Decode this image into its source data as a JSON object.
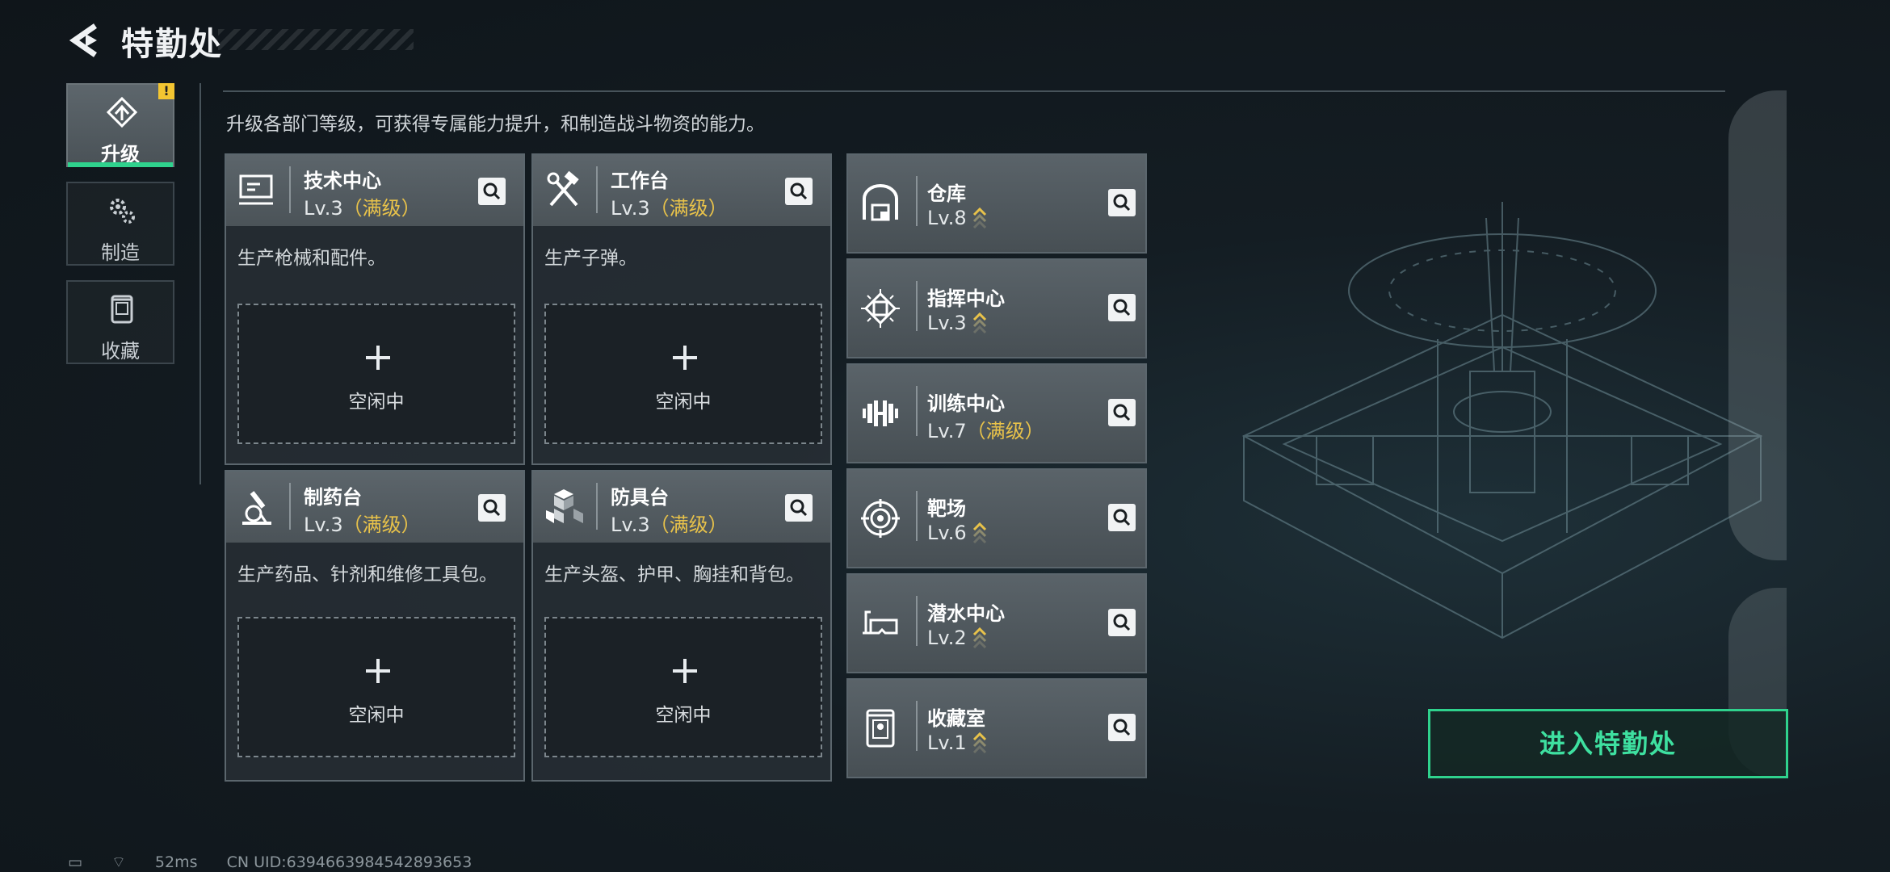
{
  "header": {
    "title": "特勤处",
    "back_icon": "back-arrow-icon"
  },
  "tabs": [
    {
      "label": "升级",
      "icon": "upgrade-icon",
      "active": true,
      "alert": "!"
    },
    {
      "label": "制造",
      "icon": "gears-icon",
      "active": false
    },
    {
      "label": "收藏",
      "icon": "collection-icon",
      "active": false
    }
  ],
  "intro": "升级各部门等级，可获得专属能力提升，和制造战斗物资的能力。",
  "workbenches": [
    {
      "name": "技术中心",
      "level": "Lv.3",
      "max": "（满级）",
      "desc": "生产枪械和配件。",
      "slot": "空闲中",
      "icon": "monitor-icon"
    },
    {
      "name": "工作台",
      "level": "Lv.3",
      "max": "（满级）",
      "desc": "生产子弹。",
      "slot": "空闲中",
      "icon": "tools-icon"
    },
    {
      "name": "制药台",
      "level": "Lv.3",
      "max": "（满级）",
      "desc": "生产药品、针剂和维修工具包。",
      "slot": "空闲中",
      "icon": "microscope-icon"
    },
    {
      "name": "防具台",
      "level": "Lv.3",
      "max": "（满级）",
      "desc": "生产头盔、护甲、胸挂和背包。",
      "slot": "空闲中",
      "icon": "cubes-icon"
    }
  ],
  "facilities": [
    {
      "name": "仓库",
      "level": "Lv.8",
      "max": "",
      "upgradable": true,
      "icon": "warehouse-icon"
    },
    {
      "name": "指挥中心",
      "level": "Lv.3",
      "max": "",
      "upgradable": true,
      "icon": "chip-icon"
    },
    {
      "name": "训练中心",
      "level": "Lv.7",
      "max": "（满级）",
      "upgradable": false,
      "icon": "dumbbell-icon"
    },
    {
      "name": "靶场",
      "level": "Lv.6",
      "max": "",
      "upgradable": true,
      "icon": "target-icon"
    },
    {
      "name": "潜水中心",
      "level": "Lv.2",
      "max": "",
      "upgradable": true,
      "icon": "diving-mask-icon"
    },
    {
      "name": "收藏室",
      "level": "Lv.1",
      "max": "",
      "upgradable": true,
      "icon": "display-case-icon"
    }
  ],
  "enter_button": "进入特勤处",
  "status": {
    "ping": "52ms",
    "uid": "CN UID:6394663984542893653"
  },
  "colors": {
    "accent": "#2fd28d",
    "max_level": "#e8c24a",
    "alert": "#f3c531"
  }
}
